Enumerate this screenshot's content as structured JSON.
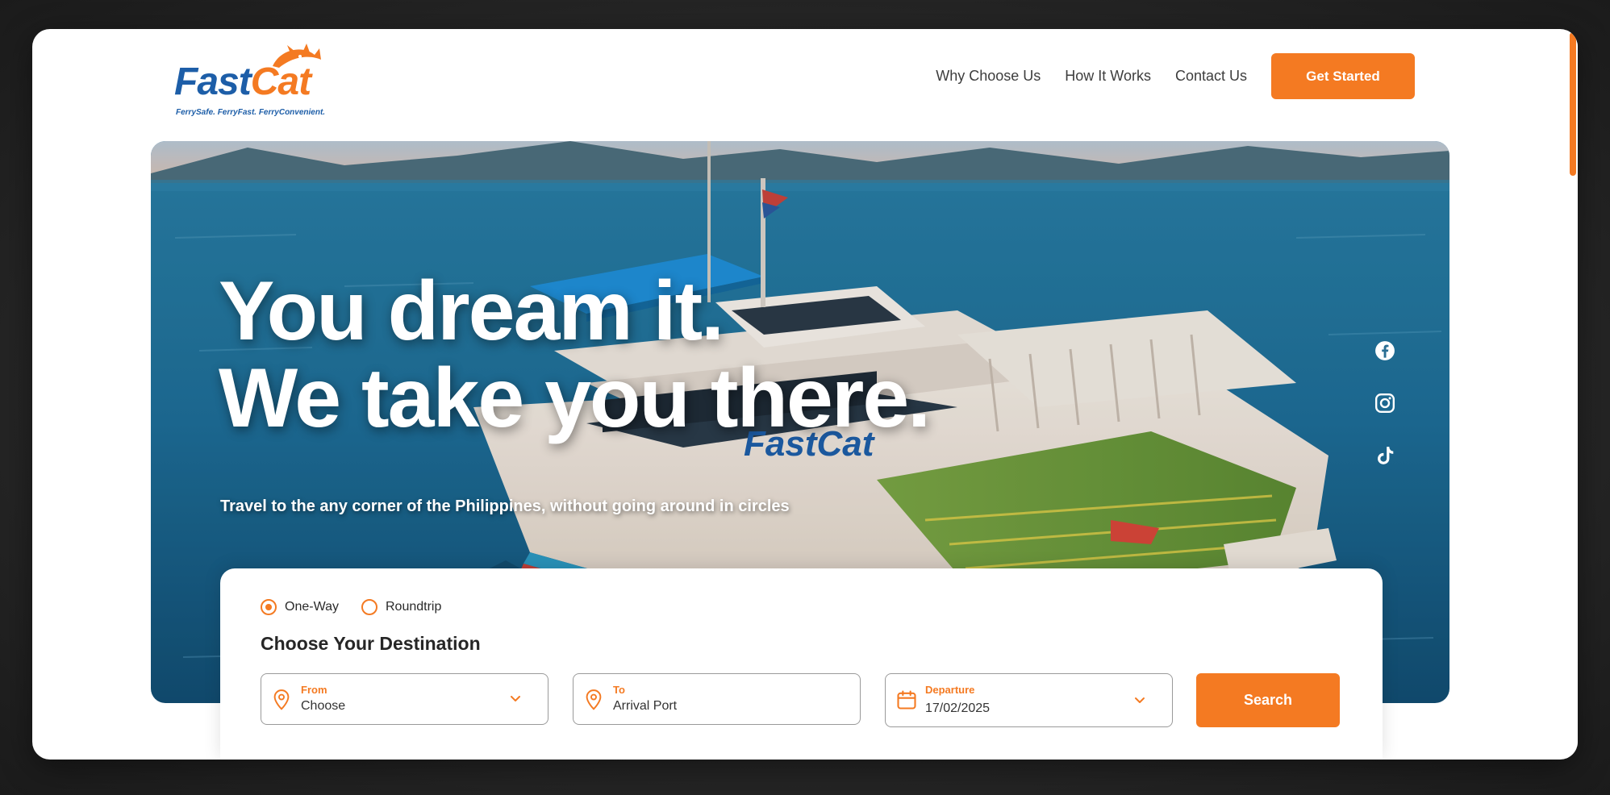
{
  "brand": {
    "name_part1": "Fast",
    "name_part2": "Cat",
    "tagline": "FerrySafe. FerryFast. FerryConvenient.",
    "primary_color": "#f47a22",
    "secondary_color": "#1d5ea8"
  },
  "nav": {
    "items": [
      {
        "label": "Why Choose Us"
      },
      {
        "label": "How It Works"
      },
      {
        "label": "Contact Us"
      }
    ],
    "cta_label": "Get Started"
  },
  "hero": {
    "title_line1": "You dream it.",
    "title_line2": "We take you there.",
    "subtitle": "Travel to the any corner of the Philippines, without going around in circles",
    "ship_logo_text": "FastCat",
    "social": [
      "facebook-icon",
      "instagram-icon",
      "tiktok-icon"
    ]
  },
  "booking": {
    "trip_types": [
      {
        "label": "One-Way",
        "selected": true
      },
      {
        "label": "Roundtrip",
        "selected": false
      }
    ],
    "title": "Choose Your Destination",
    "from": {
      "label": "From",
      "value": "Choose"
    },
    "to": {
      "label": "To",
      "placeholder": "Arrival Port"
    },
    "departure": {
      "label": "Departure",
      "value": "17/02/2025"
    },
    "search_label": "Search"
  }
}
